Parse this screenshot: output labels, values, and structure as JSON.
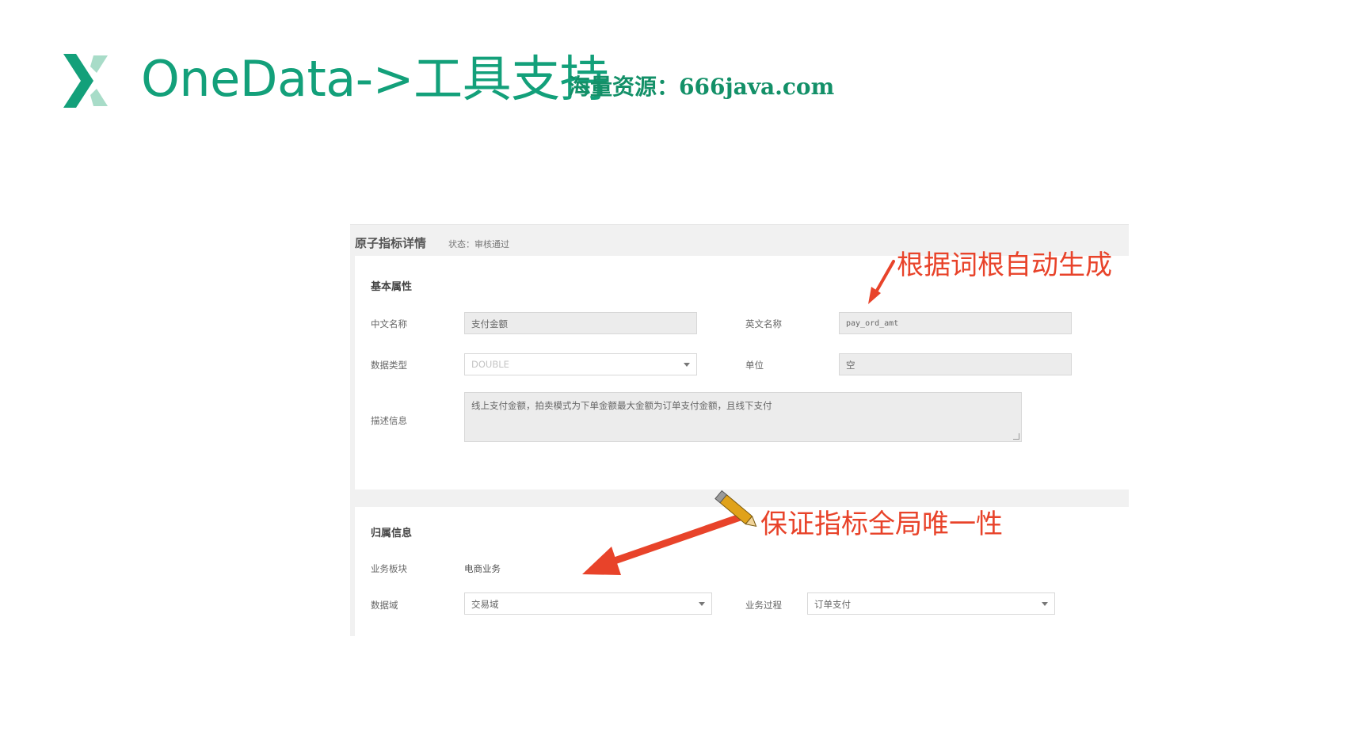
{
  "slide": {
    "title": "OneData->工具支持",
    "watermark": "海量资源：666java.com",
    "accent": "#13a07a"
  },
  "panel": {
    "title": "原子指标详情",
    "status": "状态：审核通过",
    "basic": {
      "section_title": "基本属性",
      "cn_name_label": "中文名称",
      "cn_name_value": "支付金额",
      "en_name_label": "英文名称",
      "en_name_value": "pay_ord_amt",
      "data_type_label": "数据类型",
      "data_type_value": "DOUBLE",
      "unit_label": "单位",
      "unit_value": "空",
      "desc_label": "描述信息",
      "desc_value": "线上支付金额，拍卖模式为下单金额最大金额为订单支付金额，且线下支付"
    },
    "owner": {
      "section_title": "归属信息",
      "biz_block_label": "业务板块",
      "biz_block_value": "电商业务",
      "domain_label": "数据域",
      "domain_value": "交易域",
      "process_label": "业务过程",
      "process_value": "订单支付"
    }
  },
  "annotations": {
    "top": "根据词根自动生成",
    "bottom": "保证指标全局唯一性",
    "color": "#e8432a"
  }
}
